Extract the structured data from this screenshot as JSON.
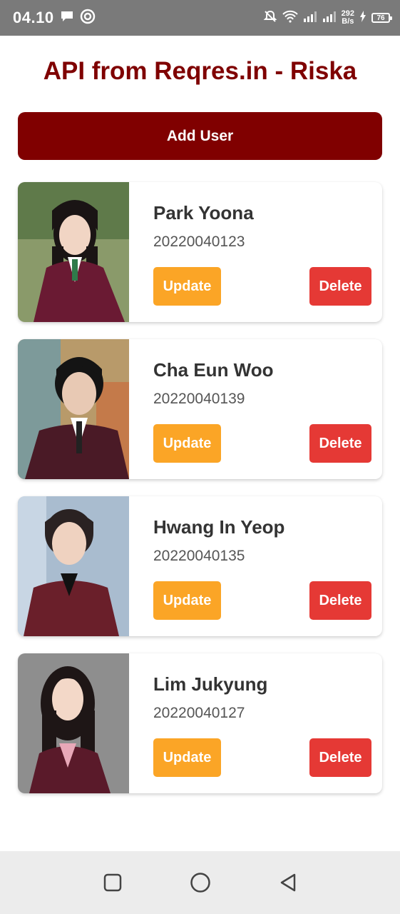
{
  "status_bar": {
    "time": "04.10",
    "speed_value": "292",
    "speed_unit": "B/s",
    "battery": "76"
  },
  "header": {
    "title": "API from Reqres.in - Riska"
  },
  "actions": {
    "add_user_label": "Add User"
  },
  "users": [
    {
      "name": "Park Yoona",
      "nim": "20220040123",
      "update_label": "Update",
      "delete_label": "Delete"
    },
    {
      "name": "Cha Eun Woo",
      "nim": "20220040139",
      "update_label": "Update",
      "delete_label": "Delete"
    },
    {
      "name": "Hwang In Yeop",
      "nim": "20220040135",
      "update_label": "Update",
      "delete_label": "Delete"
    },
    {
      "name": "Lim Jukyung",
      "nim": "20220040127",
      "update_label": "Update",
      "delete_label": "Delete"
    }
  ],
  "colors": {
    "brand": "#800000",
    "update": "#fba526",
    "delete": "#e53935"
  }
}
